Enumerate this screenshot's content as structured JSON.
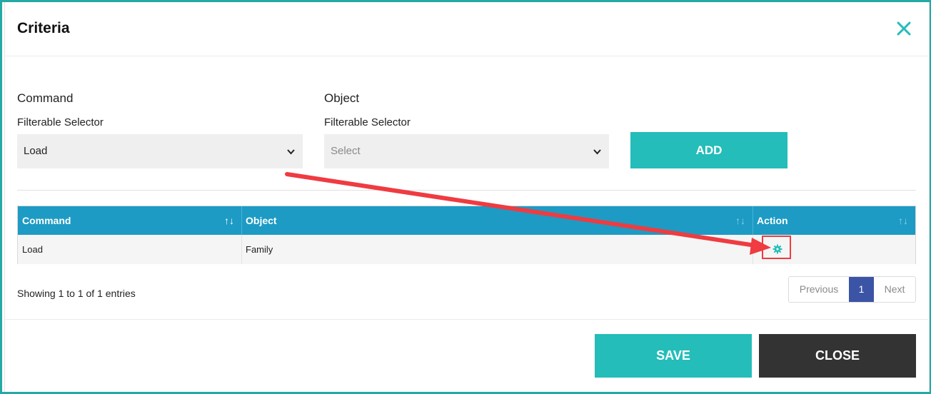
{
  "dialog": {
    "title": "Criteria"
  },
  "form": {
    "command": {
      "heading": "Command",
      "sublabel": "Filterable Selector",
      "value": "Load"
    },
    "object": {
      "heading": "Object",
      "sublabel": "Filterable Selector",
      "placeholder": "Select"
    },
    "add_label": "ADD"
  },
  "table": {
    "columns": [
      "Command",
      "Object",
      "Action"
    ],
    "rows": [
      {
        "command": "Load",
        "object": "Family"
      }
    ],
    "sort_glyph": "↑↓"
  },
  "footer_info": "Showing 1 to 1 of 1 entries",
  "pagination": {
    "previous": "Previous",
    "current": "1",
    "next": "Next"
  },
  "actions": {
    "save": "SAVE",
    "close": "CLOSE"
  },
  "colors": {
    "accent": "#24bdb9",
    "table_header": "#1d9bc4",
    "annotation": "#ef3b41",
    "active_page": "#3b54a5",
    "dark_button": "#333333"
  },
  "icons": {
    "close": "close-icon",
    "chevron": "chevron-down-icon",
    "action": "gear-icon"
  }
}
